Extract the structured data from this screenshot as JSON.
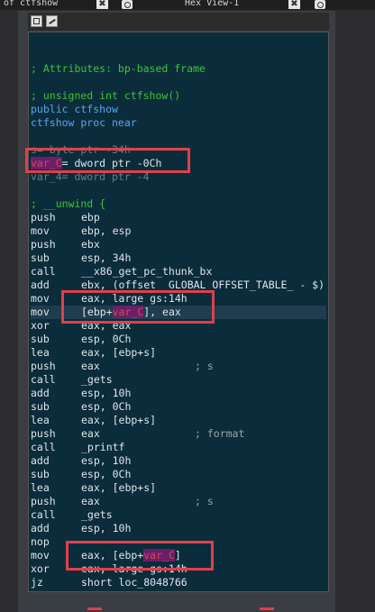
{
  "tabs": {
    "left_label": "of ctfshow",
    "right_label": "Hex View-1",
    "close_glyph": "✖"
  },
  "code_lines": [
    {
      "id": "blank0",
      "text": ""
    },
    {
      "id": "blank1",
      "text": ""
    },
    {
      "id": "attr",
      "text": "; Attributes: bp-based frame",
      "style": "comment"
    },
    {
      "id": "blank2",
      "text": ""
    },
    {
      "id": "sig",
      "text": "; unsigned int ctfshow()",
      "style": "comment"
    },
    {
      "id": "public",
      "text": "public ctfshow",
      "style": "blue"
    },
    {
      "id": "proc",
      "text": "ctfshow proc near",
      "style": "blue"
    },
    {
      "id": "blank3",
      "text": ""
    },
    {
      "id": "s_var",
      "text": "s= byte ptr -34h",
      "style": "faded"
    },
    {
      "id": "varc",
      "mnem": "var_C",
      "op": "= dword ptr -0Ch"
    },
    {
      "id": "var4",
      "text": "var_4= dword ptr -4",
      "style": "faded"
    },
    {
      "id": "blank4",
      "text": ""
    },
    {
      "id": "unwind",
      "text": "; __unwind {",
      "style": "comment"
    },
    {
      "id": "i1",
      "mnem": "push",
      "op": "ebp"
    },
    {
      "id": "i2",
      "mnem": "mov",
      "op": "ebp, esp"
    },
    {
      "id": "i3",
      "mnem": "push",
      "op": "ebx"
    },
    {
      "id": "i4",
      "mnem": "sub",
      "op": "esp, 34h"
    },
    {
      "id": "i5",
      "mnem": "call",
      "op": "__x86_get_pc_thunk_bx",
      "opstyle": "blue"
    },
    {
      "id": "i6",
      "mnem": "add",
      "op": "ebx, (offset _GLOBAL_OFFSET_TABLE_ - $)"
    },
    {
      "id": "i7",
      "mnem": "mov",
      "op": "eax, large gs:14h"
    },
    {
      "id": "i8",
      "mnem": "mov",
      "op_pre": "[ebp+",
      "op_hl": "var_C",
      "op_post": "], eax",
      "hl": true
    },
    {
      "id": "i9",
      "mnem": "xor",
      "op": "eax, eax"
    },
    {
      "id": "i10",
      "mnem": "sub",
      "op": "esp, 0Ch"
    },
    {
      "id": "i11",
      "mnem": "lea",
      "op": "eax, [ebp+s]"
    },
    {
      "id": "i12",
      "mnem": "push",
      "op": "eax",
      "cmt": "; s"
    },
    {
      "id": "i13",
      "mnem": "call",
      "op": "_gets",
      "opstyle": "blue"
    },
    {
      "id": "i14",
      "mnem": "add",
      "op": "esp, 10h"
    },
    {
      "id": "i15",
      "mnem": "sub",
      "op": "esp, 0Ch"
    },
    {
      "id": "i16",
      "mnem": "lea",
      "op": "eax, [ebp+s]"
    },
    {
      "id": "i17",
      "mnem": "push",
      "op": "eax",
      "cmt": "; format"
    },
    {
      "id": "i18",
      "mnem": "call",
      "op": "_printf",
      "opstyle": "blue"
    },
    {
      "id": "i19",
      "mnem": "add",
      "op": "esp, 10h"
    },
    {
      "id": "i20",
      "mnem": "sub",
      "op": "esp, 0Ch"
    },
    {
      "id": "i21",
      "mnem": "lea",
      "op": "eax, [ebp+s]"
    },
    {
      "id": "i22",
      "mnem": "push",
      "op": "eax",
      "cmt": "; s"
    },
    {
      "id": "i23",
      "mnem": "call",
      "op": "_gets",
      "opstyle": "blue"
    },
    {
      "id": "i24",
      "mnem": "add",
      "op": "esp, 10h"
    },
    {
      "id": "i25",
      "mnem": "nop",
      "op": ""
    },
    {
      "id": "i26",
      "mnem": "mov",
      "op_pre": "eax, [ebp+",
      "op_hl": "var_C",
      "op_post": "]"
    },
    {
      "id": "i27",
      "mnem": "xor",
      "op": "eax, large gs:14h"
    },
    {
      "id": "i28",
      "mnem": "jz",
      "op": "short loc_8048766",
      "opstyle": "blue"
    }
  ],
  "colors": {
    "code_bg": "#0b2c3a",
    "annotation_red": "#e0404a",
    "highlight_purple": "#6b1f6b"
  }
}
